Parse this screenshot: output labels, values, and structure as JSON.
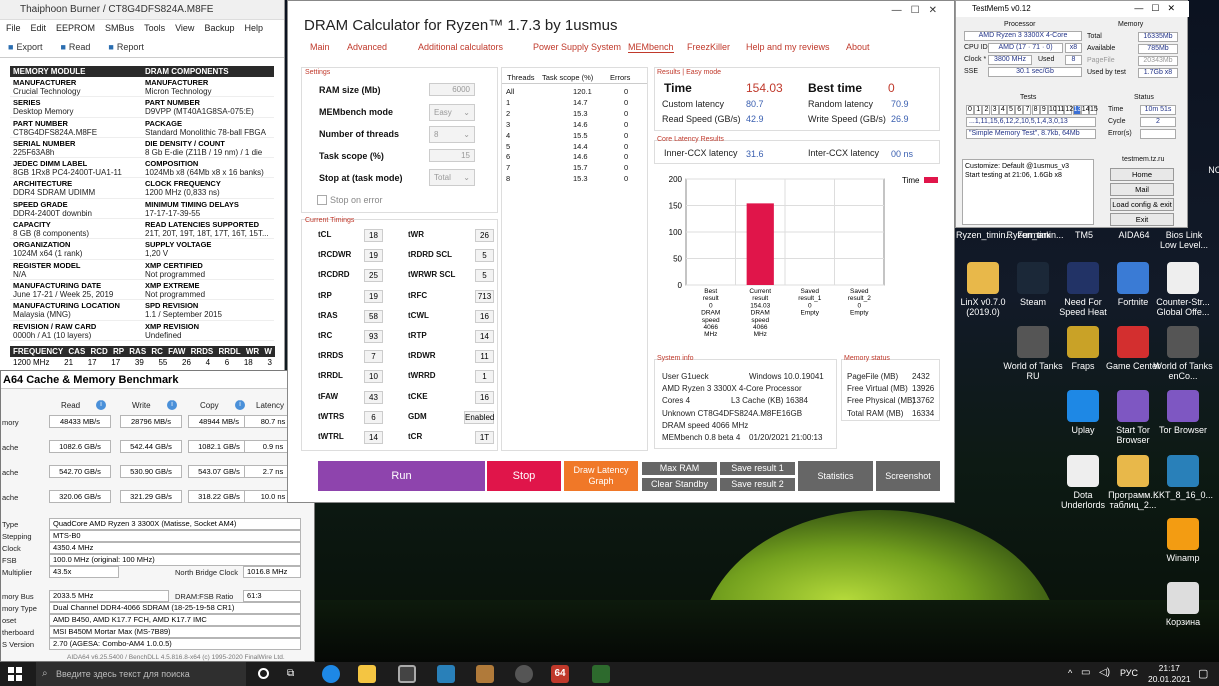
{
  "desktop": {
    "icons": [
      {
        "label": "LinX v0.7.0 (2019.0)",
        "icon": "folder-icon"
      },
      {
        "label": "Steam",
        "icon": "steam-icon"
      },
      {
        "label": "Need For Speed Heat",
        "icon": "nfs-icon"
      },
      {
        "label": "Fortnite",
        "icon": "fortnite-icon"
      },
      {
        "label": "Counter-Str... Global Offe...",
        "icon": "file-icon"
      },
      {
        "label": "World of Tanks RU",
        "icon": "wot-icon"
      },
      {
        "label": "Fraps",
        "icon": "fraps-icon"
      },
      {
        "label": "Game Center",
        "icon": "gamecenter-icon"
      },
      {
        "label": "World of Tanks enCo...",
        "icon": "wot-icon"
      },
      {
        "label": "Uplay",
        "icon": "uplay-icon"
      },
      {
        "label": "Start Tor Browser",
        "icon": "tor-icon"
      },
      {
        "label": "Tor Browser",
        "icon": "tor-icon"
      },
      {
        "label": "Dota Underlords",
        "icon": "file-icon"
      },
      {
        "label": "Программ... таблиц_2...",
        "icon": "folder-icon"
      },
      {
        "label": "KKT_8_16_0...",
        "icon": "installer-icon"
      },
      {
        "label": "Winamp",
        "icon": "winamp-icon"
      },
      {
        "label": "Корзина",
        "icon": "recycle-bin-icon"
      }
    ],
    "partial_labels": [
      "Ryzen_timin...",
      "Furmark",
      "TM5",
      "AIDA64",
      "Bios Link",
      "Low Level...",
      "NCH"
    ]
  },
  "thaiphoon": {
    "title": "Thaiphoon Burner / CT8G4DFS824A.M8FE",
    "menu": [
      "File",
      "Edit",
      "EEPROM",
      "SMBus",
      "Tools",
      "View",
      "Backup",
      "Help"
    ],
    "toolbar": [
      "Export",
      "Read",
      "Report"
    ],
    "headers": [
      "MEMORY MODULE",
      "DRAM COMPONENTS"
    ],
    "rows": [
      {
        "k1": "MANUFACTURER",
        "v1": "Crucial Technology",
        "k2": "MANUFACTURER",
        "v2": "Micron Technology"
      },
      {
        "k1": "SERIES",
        "v1": "Desktop Memory",
        "k2": "PART NUMBER",
        "v2": "D9VPP (MT40A1G8SA-075:E)"
      },
      {
        "k1": "PART NUMBER",
        "v1": "CT8G4DFS824A.M8FE",
        "k2": "PACKAGE",
        "v2": "Standard Monolithic 78-ball FBGA"
      },
      {
        "k1": "SERIAL NUMBER",
        "v1": "225F63A8h",
        "k2": "DIE DENSITY / COUNT",
        "v2": "8 Gb E-die (Z11B / 19 nm) / 1 die"
      },
      {
        "k1": "JEDEC DIMM LABEL",
        "v1": "8GB 1Rx8 PC4-2400T-UA1-11",
        "k2": "COMPOSITION",
        "v2": "1024Mb x8 (64Mb x8 x 16 banks)"
      },
      {
        "k1": "ARCHITECTURE",
        "v1": "DDR4 SDRAM UDIMM",
        "k2": "CLOCK FREQUENCY",
        "v2": "1200 MHz (0,833 ns)"
      },
      {
        "k1": "SPEED GRADE",
        "v1": "DDR4-2400T downbin",
        "k2": "MINIMUM TIMING DELAYS",
        "v2": "17-17-17-39-55"
      },
      {
        "k1": "CAPACITY",
        "v1": "8 GB (8 components)",
        "k2": "READ LATENCIES SUPPORTED",
        "v2": "21T, 20T, 19T, 18T, 17T, 16T, 15T..."
      },
      {
        "k1": "ORGANIZATION",
        "v1": "1024M x64 (1 rank)",
        "k2": "SUPPLY VOLTAGE",
        "v2": "1,20 V"
      },
      {
        "k1": "REGISTER MODEL",
        "v1": "N/A",
        "k2": "XMP CERTIFIED",
        "v2": "Not programmed"
      },
      {
        "k1": "MANUFACTURING DATE",
        "v1": "June 17-21 / Week 25, 2019",
        "k2": "XMP EXTREME",
        "v2": "Not programmed"
      },
      {
        "k1": "MANUFACTURING LOCATION",
        "v1": "Malaysia (MNG)",
        "k2": "SPD REVISION",
        "v2": "1.1 / September 2015"
      },
      {
        "k1": "REVISION / RAW CARD",
        "v1": "0000h / A1 (10 layers)",
        "k2": "XMP REVISION",
        "v2": "Undefined"
      }
    ],
    "freq_headers": [
      "FREQUENCY",
      "CAS",
      "RCD",
      "RP",
      "RAS",
      "RC",
      "FAW",
      "RRDS",
      "RRDL",
      "WR",
      "W"
    ],
    "freq_row": [
      "1200 MHz",
      "21",
      "17",
      "17",
      "39",
      "55",
      "26",
      "4",
      "6",
      "18",
      "3"
    ]
  },
  "aida": {
    "title": "A64 Cache & Memory Benchmark",
    "col_headers": [
      "Read",
      "Write",
      "Copy",
      "Latency"
    ],
    "rows": [
      {
        "label": "mory",
        "read": "48433 MB/s",
        "write": "28796 MB/s",
        "copy": "48944 MB/s",
        "latency": "80.7 ns"
      },
      {
        "label": "ache",
        "read": "1082.6 GB/s",
        "write": "542.44 GB/s",
        "copy": "1082.1 GB/s",
        "latency": "0.9 ns"
      },
      {
        "label": "ache",
        "read": "542.70 GB/s",
        "write": "530.90 GB/s",
        "copy": "543.07 GB/s",
        "latency": "2.7 ns"
      },
      {
        "label": "ache",
        "read": "320.06 GB/s",
        "write": "321.29 GB/s",
        "copy": "318.22 GB/s",
        "latency": "10.0 ns"
      }
    ],
    "info": [
      {
        "label": "Type",
        "value": "QuadCore AMD Ryzen 3 3300X  (Matisse, Socket AM4)"
      },
      {
        "label": "Stepping",
        "value": "MTS-B0"
      },
      {
        "label": "Clock",
        "value": "4350.4 MHz"
      },
      {
        "label": "FSB",
        "value": "100.0 MHz  (original: 100 MHz)"
      },
      {
        "label": "Multiplier",
        "value": "43.5x"
      },
      {
        "label": "mory Bus",
        "value": "2033.5 MHz"
      },
      {
        "label": "mory Type",
        "value": "Dual Channel DDR4-4066 SDRAM  (18-25-19-58 CR1)"
      },
      {
        "label": "oset",
        "value": "AMD B450, AMD K17.7 FCH, AMD K17.7 IMC"
      },
      {
        "label": "therboard",
        "value": "MSI B450M Mortar Max (MS-7B89)"
      },
      {
        "label": "S Version",
        "value": "2.70  (AGESA: Combo-AM4 1.0.0.5)"
      }
    ],
    "nb_label": "North Bridge Clock",
    "nb_value": "1016.8 MHz",
    "ratio_label": "DRAM:FSB Ratio",
    "ratio_value": "61:3",
    "footer": "AIDA64 v6.25.5400 / BenchDLL 4.5.816.8-x64  (c) 1995-2020 FinalWire Ltd."
  },
  "dram": {
    "title": "DRAM Calculator for Ryzen™ 1.7.3 by 1usmus",
    "tabs": [
      "Main",
      "Advanced",
      "Additional calculators",
      "Power Supply System",
      "MEMbench",
      "FreezKiller",
      "Help and my reviews",
      "About"
    ],
    "settings_label": "Settings",
    "ram_size_label": "RAM size (Mb)",
    "ram_size": "6000",
    "mode_label": "MEMbench mode",
    "mode": "Easy",
    "threads_label": "Number of threads",
    "threads": "8",
    "scope_label": "Task scope (%)",
    "scope": "15",
    "stop_label": "Stop at (task mode)",
    "stop": "Total",
    "stop_err": "Stop on error",
    "table_headers": [
      "Threads",
      "Task scope (%)",
      "Errors"
    ],
    "table_rows": [
      [
        "All",
        "120.1",
        "0"
      ],
      [
        "1",
        "14.7",
        "0"
      ],
      [
        "2",
        "15.3",
        "0"
      ],
      [
        "3",
        "14.6",
        "0"
      ],
      [
        "4",
        "15.5",
        "0"
      ],
      [
        "5",
        "14.4",
        "0"
      ],
      [
        "6",
        "14.6",
        "0"
      ],
      [
        "7",
        "15.7",
        "0"
      ],
      [
        "8",
        "15.3",
        "0"
      ]
    ],
    "timings_label": "Current Timings",
    "timings_left": [
      [
        "tCL",
        "18"
      ],
      [
        "tRCDWR",
        "19"
      ],
      [
        "tRCDRD",
        "25"
      ],
      [
        "tRP",
        "19"
      ],
      [
        "tRAS",
        "58"
      ],
      [
        "tRC",
        "93"
      ],
      [
        "tRRDS",
        "7"
      ],
      [
        "tRRDL",
        "10"
      ],
      [
        "tFAW",
        "43"
      ],
      [
        "tWTRS",
        "6"
      ],
      [
        "tWTRL",
        "14"
      ]
    ],
    "timings_right": [
      [
        "tWR",
        "26"
      ],
      [
        "tRDRD SCL",
        "5"
      ],
      [
        "tWRWR SCL",
        "5"
      ],
      [
        "tRFC",
        "713"
      ],
      [
        "tCWL",
        "16"
      ],
      [
        "tRTP",
        "14"
      ],
      [
        "tRDWR",
        "11"
      ],
      [
        "tWRRD",
        "1"
      ],
      [
        "tCKE",
        "16"
      ],
      [
        "GDM",
        "Enabled"
      ],
      [
        "tCR",
        "1T"
      ]
    ],
    "results_label": "Results",
    "mode_tag": "Easy mode",
    "time_label": "Time",
    "time": "154.03",
    "best_label": "Best time",
    "best": "0",
    "custom_lat_label": "Custom latency",
    "custom_lat": "80.7",
    "random_lat_label": "Random latency",
    "random_lat": "70.9",
    "read_label": "Read Speed (GB/s)",
    "read": "42.9",
    "write_label": "Write Speed (GB/s)",
    "write": "26.9",
    "ccx_label": "Core Latency Results",
    "inner_label": "Inner-CCX latency",
    "inner": "31.6",
    "inter_label": "Inter-CCX latency",
    "inter": "00 ns",
    "sys_label": "System info",
    "sys": [
      [
        "User G1ueck",
        "Windows 10.0.19041"
      ],
      [
        "AMD Ryzen 3 3300X 4-Core Processor",
        ""
      ],
      [
        "Cores 4",
        "L3 Cache (KB)   16384"
      ],
      [
        "Unknown CT8G4DFS824A.M8FE16GB",
        ""
      ],
      [
        "DRAM speed 4066 MHz",
        ""
      ],
      [
        "MEMbench 0.8 beta 4",
        "01/20/2021 21:00:13"
      ]
    ],
    "mem_label": "Memory status",
    "mem": [
      [
        "PageFile (MB)",
        "2432"
      ],
      [
        "Free Virtual (MB)",
        "13926"
      ],
      [
        "Free Physical (MB)",
        "13762"
      ],
      [
        "Total RAM (MB)",
        "16334"
      ]
    ],
    "buttons": {
      "run": "Run",
      "stop": "Stop",
      "draw": "Draw Latency Graph",
      "maxram": "Max RAM",
      "clear": "Clear Standby",
      "save1": "Save result 1",
      "save2": "Save result 2",
      "stats": "Statistics",
      "screenshot": "Screenshot"
    },
    "colors": {
      "run": "#8e44ad",
      "stop": "#e0154a",
      "draw": "#f07828",
      "accent": "#c0392b"
    }
  },
  "chart_data": {
    "type": "bar",
    "categories": [
      "Best result 0 DRAM speed 4066 MHz",
      "Current result 154.03 DRAM speed 4066 MHz",
      "Saved result_1 0 Empty",
      "Saved result_2 0 Empty"
    ],
    "category_lines": [
      [
        "Best",
        "result",
        "0",
        "DRAM",
        "speed",
        "4066",
        "MHz"
      ],
      [
        "Current",
        "result",
        "154.03",
        "DRAM",
        "speed",
        "4066",
        "MHz"
      ],
      [
        "Saved",
        "result_1",
        "0",
        "Empty"
      ],
      [
        "Saved",
        "result_2",
        "0",
        "Empty"
      ]
    ],
    "series": [
      {
        "name": "Time",
        "values": [
          0,
          154.03,
          0,
          0
        ],
        "color": "#e0154a"
      }
    ],
    "ylim": [
      0,
      200
    ],
    "yticks": [
      0,
      50,
      100,
      150,
      200
    ],
    "legend": "top-right",
    "grid": true,
    "title": "",
    "xlabel": "",
    "ylabel": ""
  },
  "testmem": {
    "title": "TestMem5 v0.12",
    "proc_label": "Processor",
    "cpu": "AMD Ryzen 3 3300X 4-Core",
    "cpuid_label": "CPU ID",
    "cpuid": "AMD (17 · 71 · 0)",
    "cpuid_x": "x8",
    "clock_label": "Clock *",
    "clock": "3800 MHz",
    "used_label": "Used",
    "used": "8",
    "sse_label": "SSE",
    "sse": "30.1 sec/Gb",
    "mem_label": "Memory",
    "total_label": "Total",
    "total": "16335Mb",
    "avail_label": "Available",
    "avail": "785Mb",
    "pagefile_label": "PageFile",
    "pagefile": "20343Mb",
    "usedby_label": "Used by test",
    "usedby": "1.7Gb x8",
    "tests_label": "Tests",
    "tests": [
      "0",
      "1",
      "2",
      "3",
      "4",
      "5",
      "6",
      "7",
      "8",
      "9",
      "10",
      "11",
      "12",
      "13",
      "14",
      "15"
    ],
    "seq": "...1,11,15,6,12,2,10,5,1,4,3,0,13",
    "config": "\"Simple Memory Test\", 8.7kb, 64Mb",
    "status_label": "Status",
    "time_label": "Time",
    "time": "10m 51s",
    "cycle_label": "Cycle",
    "cycle": "2",
    "err_label": "Error(s)",
    "err": "",
    "log": [
      "Customize: Default @1usmus_v3",
      "Start testing at 21:06, 1.6Gb x8"
    ],
    "site": "testmem.tz.ru",
    "buttons": [
      "Home",
      "Mail",
      "Load config & exit",
      "Exit"
    ]
  },
  "taskbar": {
    "search": "Введите здесь текст для поиска",
    "lang": "РУС",
    "time": "21:17",
    "date": "20.01.2021"
  }
}
